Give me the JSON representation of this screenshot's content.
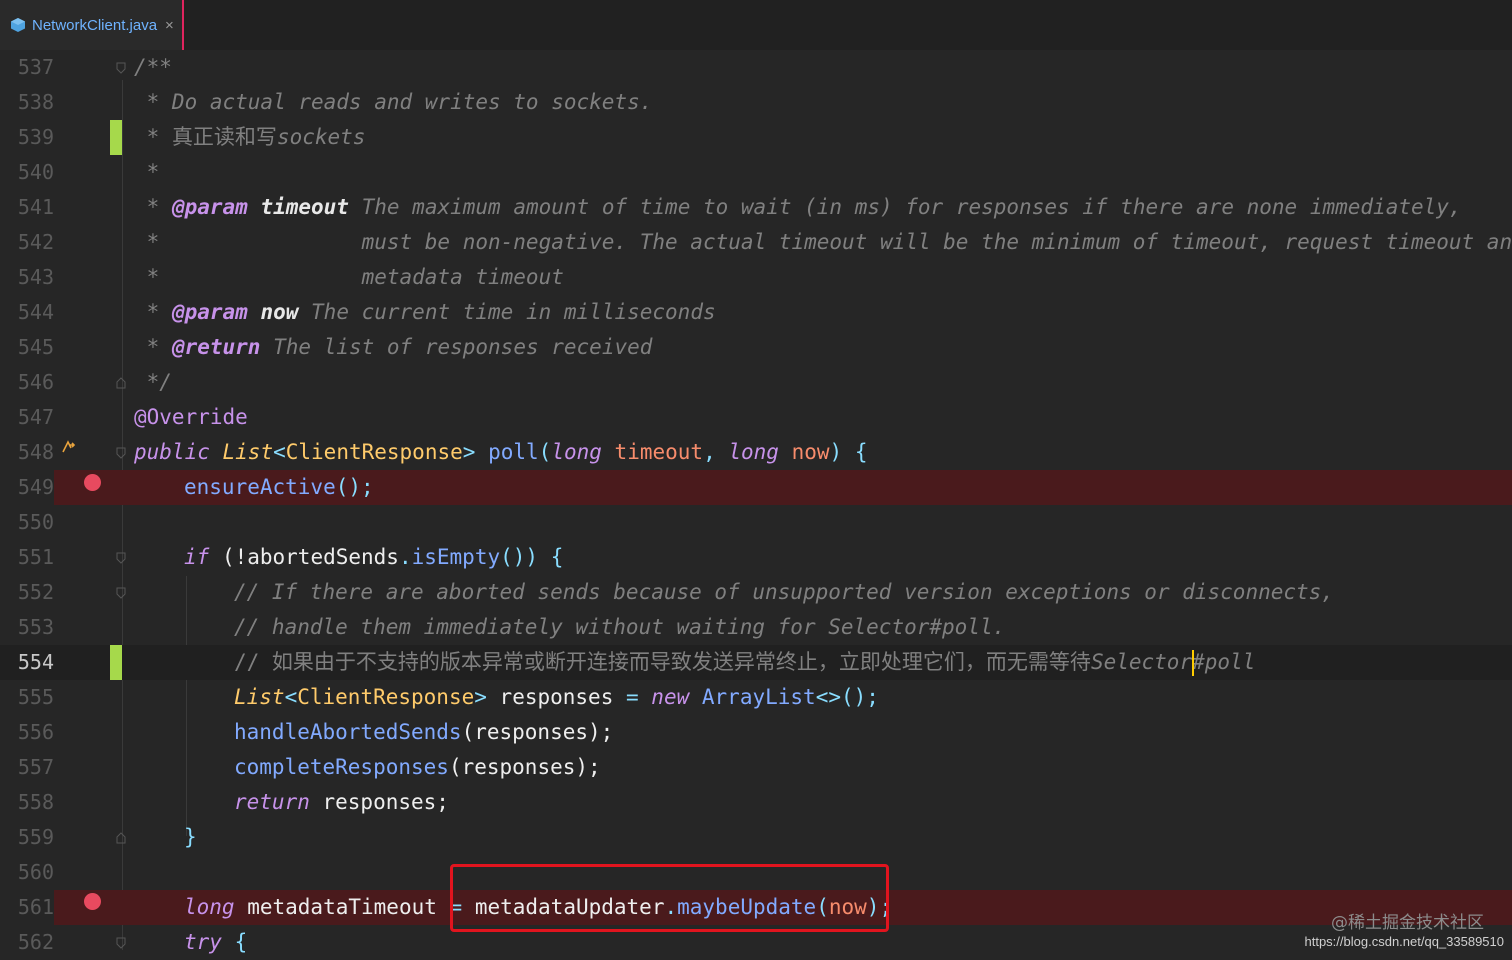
{
  "tab": {
    "label": "NetworkClient.java",
    "close": "×"
  },
  "lines": [
    {
      "n": "537"
    },
    {
      "n": "538"
    },
    {
      "n": "539"
    },
    {
      "n": "540"
    },
    {
      "n": "541"
    },
    {
      "n": "542"
    },
    {
      "n": "543"
    },
    {
      "n": "544"
    },
    {
      "n": "545"
    },
    {
      "n": "546"
    },
    {
      "n": "547"
    },
    {
      "n": "548"
    },
    {
      "n": "549"
    },
    {
      "n": "550"
    },
    {
      "n": "551"
    },
    {
      "n": "552"
    },
    {
      "n": "553"
    },
    {
      "n": "554"
    },
    {
      "n": "555"
    },
    {
      "n": "556"
    },
    {
      "n": "557"
    },
    {
      "n": "558"
    },
    {
      "n": "559"
    },
    {
      "n": "560"
    },
    {
      "n": "561"
    },
    {
      "n": "562"
    }
  ],
  "code": {
    "l537": "/**",
    "l538": " * Do actual reads and writes to sockets.",
    "l539_star": " * ",
    "l539_cjk": "真正读和写",
    "l539_rest": "sockets",
    "l540": " *",
    "l541_star": " * ",
    "l541_tag": "@param",
    "l541_name": "timeout",
    "l541_text": " The maximum amount of time to wait (in ms) for responses if there are none immediately,",
    "l542": " *                must be non-negative. The actual timeout will be the minimum of timeout, request timeout and",
    "l543": " *                metadata timeout",
    "l544_star": " * ",
    "l544_tag": "@param",
    "l544_name": "now",
    "l544_text": " The current time in milliseconds",
    "l545_star": " * ",
    "l545_tag": "@return",
    "l545_text": " The list of responses received",
    "l546": " */",
    "l547": "@Override",
    "l548_public": "public",
    "l548_list": "List",
    "l548_lt": "<",
    "l548_type": "ClientResponse",
    "l548_gt": ">",
    "l548_fn": "poll",
    "l548_open": "(",
    "l548_long1": "long",
    "l548_timeout": "timeout",
    "l548_comma": ",",
    "l548_long2": "long",
    "l548_now": "now",
    "l548_close": ")",
    "l548_brace": "{",
    "l549_fn": "ensureActive",
    "l549_rest": "();",
    "l551_if": "if",
    "l551_a": " (!abortedSends",
    "l551_dot": ".",
    "l551_fn": "isEmpty",
    "l551_b": "()) {",
    "l552": "// If there are aborted sends because of unsupported version exceptions or disconnects,",
    "l553": "// handle them immediately without waiting for Selector#poll.",
    "l554_a": "// 如果由于不支持的版本异常或断开连接而导致发送异常终止，立即处理它们，而无需等待",
    "l554_b": "Selector#poll",
    "l555_list": "List",
    "l555_lt": "<",
    "l555_type": "ClientResponse",
    "l555_gt": ">",
    "l555_var": " responses ",
    "l555_eq": "=",
    "l555_new": "new",
    "l555_cls": "ArrayList",
    "l555_rest": "<>();",
    "l556_fn": "handleAbortedSends",
    "l556_rest": "(responses);",
    "l557_fn": "completeResponses",
    "l557_rest": "(responses);",
    "l558_ret": "return",
    "l558_rest": " responses;",
    "l559": "}",
    "l561_long": "long",
    "l561_var": " metadataTimeout ",
    "l561_eq": "=",
    "l561_obj": " metadataUpdater",
    "l561_dot": ".",
    "l561_fn": "maybeUpdate",
    "l561_open": "(",
    "l561_now": "now",
    "l561_close": ");",
    "l562_try": "try",
    "l562_rest": " {"
  },
  "watermark": {
    "site": "@稀土掘金技术社区",
    "url": "https://blog.csdn.net/qq_33589510"
  },
  "colors": {
    "accent_tab": "#e0245e",
    "breakpoint": "#e84a5f",
    "breakpoint_line": "#4a1a1c",
    "change_marker": "#a6d94b",
    "highlight_box": "#e1141e"
  }
}
